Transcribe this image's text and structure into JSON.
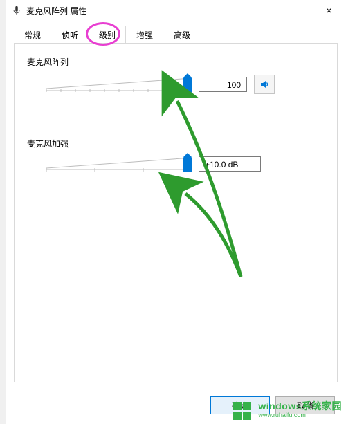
{
  "window": {
    "title": "麦克风阵列 属性",
    "close": "×"
  },
  "tabs": {
    "items": [
      {
        "label": "常规"
      },
      {
        "label": "侦听"
      },
      {
        "label": "级别"
      },
      {
        "label": "增强"
      },
      {
        "label": "高级"
      }
    ],
    "activeIndex": 2
  },
  "sliders": {
    "level": {
      "label": "麦克风阵列",
      "value": "100",
      "position": 0.97
    },
    "boost": {
      "label": "麦克风加强",
      "value": "+10.0 dB",
      "position": 0.97
    }
  },
  "buttons": {
    "ok": "确定",
    "cancel": "取消"
  },
  "watermark": {
    "line1": "windows系统家园",
    "line2": "www.ruhaifu.com"
  },
  "icons": {
    "speaker": "speaker-icon"
  }
}
